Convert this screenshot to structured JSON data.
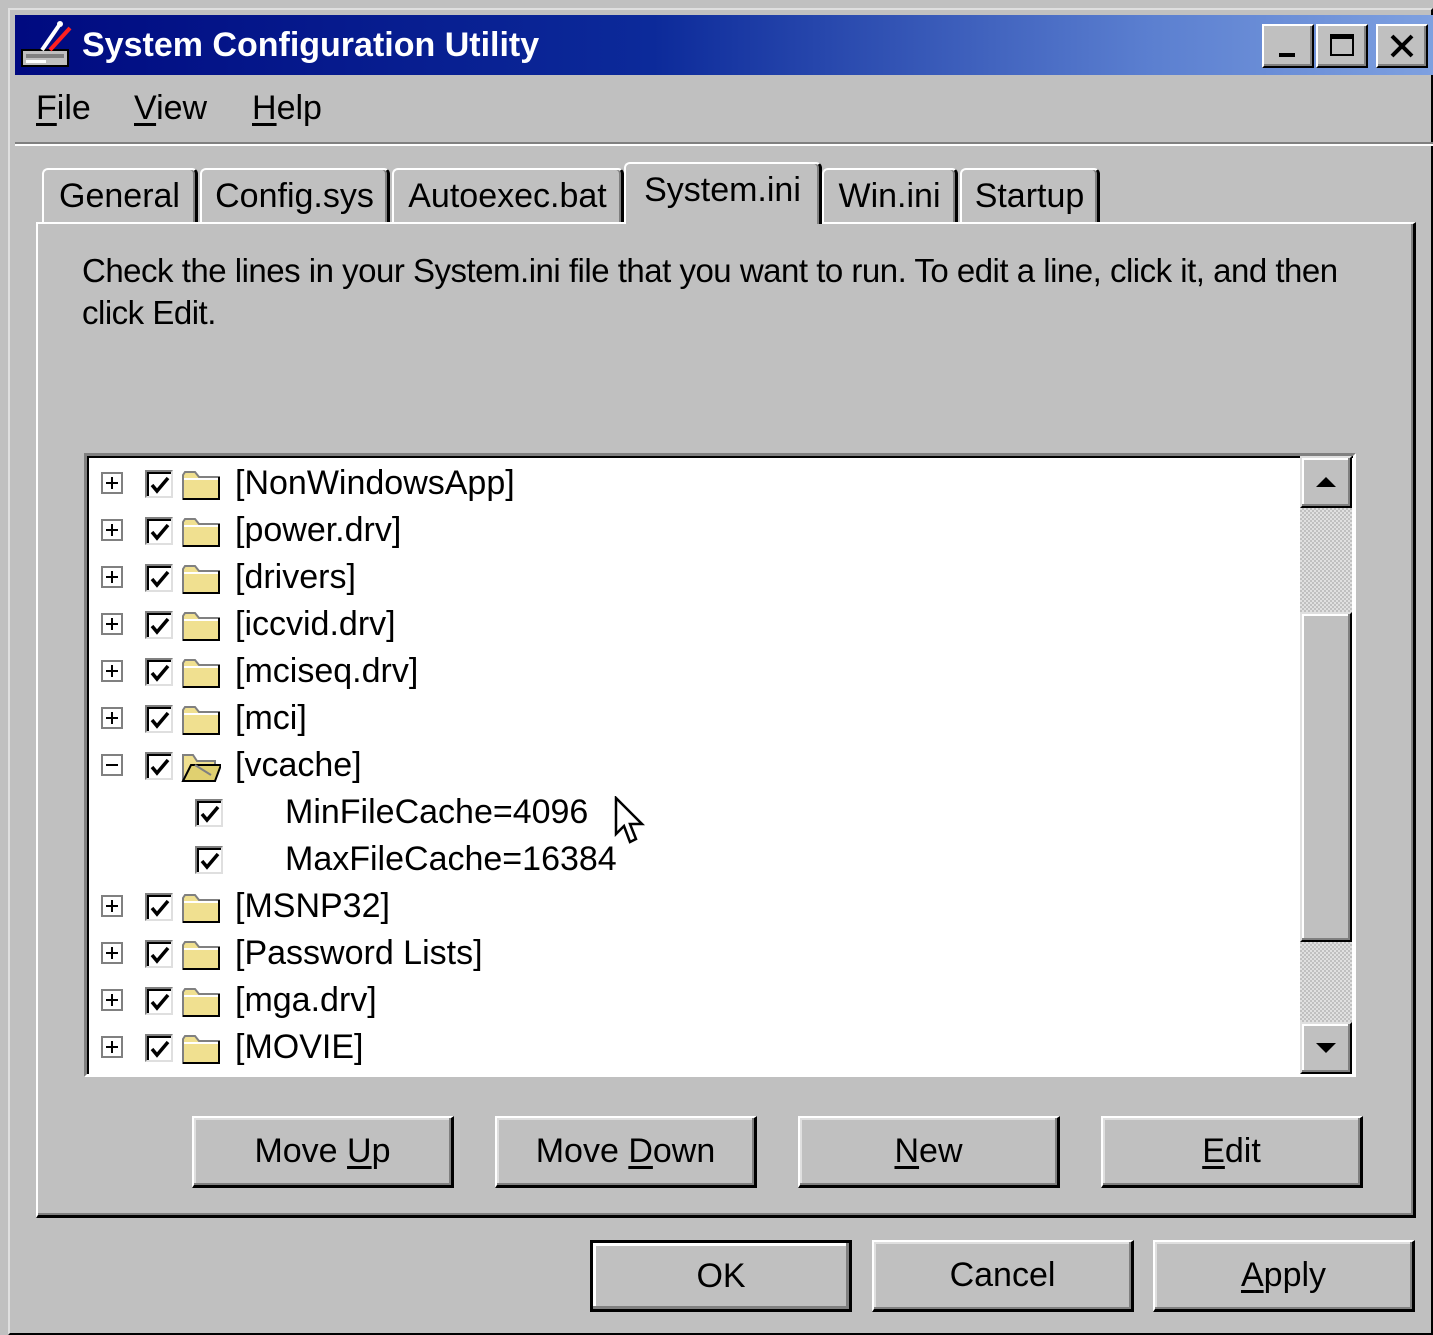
{
  "window": {
    "title": "System Configuration Utility"
  },
  "menu": [
    {
      "pre": "",
      "key": "F",
      "post": "ile"
    },
    {
      "pre": "",
      "key": "V",
      "post": "iew"
    },
    {
      "pre": "",
      "key": "H",
      "post": "elp"
    }
  ],
  "tabs": [
    "General",
    "Config.sys",
    "Autoexec.bat",
    "System.ini",
    "Win.ini",
    "Startup"
  ],
  "active_tab": "System.ini",
  "instructions": "Check the lines in your System.ini file that you want to run. To edit a line, click it, and then click Edit.",
  "tree": [
    {
      "label": "[NonWindowsApp]",
      "checked": true,
      "expander": "plus",
      "folder": "closed"
    },
    {
      "label": "[power.drv]",
      "checked": true,
      "expander": "plus",
      "folder": "closed"
    },
    {
      "label": "[drivers]",
      "checked": true,
      "expander": "plus",
      "folder": "closed"
    },
    {
      "label": "[iccvid.drv]",
      "checked": true,
      "expander": "plus",
      "folder": "closed"
    },
    {
      "label": "[mciseq.drv]",
      "checked": true,
      "expander": "plus",
      "folder": "closed"
    },
    {
      "label": "[mci]",
      "checked": true,
      "expander": "plus",
      "folder": "closed"
    },
    {
      "label": "[vcache]",
      "checked": true,
      "expander": "minus",
      "folder": "open"
    },
    {
      "label": "MinFileCache=4096",
      "checked": true,
      "expander": "none",
      "folder": "none"
    },
    {
      "label": "MaxFileCache=16384",
      "checked": true,
      "expander": "none",
      "folder": "none"
    },
    {
      "label": "[MSNP32]",
      "checked": true,
      "expander": "plus",
      "folder": "closed"
    },
    {
      "label": "[Password Lists]",
      "checked": true,
      "expander": "plus",
      "folder": "closed"
    },
    {
      "label": "[mga.drv]",
      "checked": true,
      "expander": "plus",
      "folder": "closed"
    },
    {
      "label": "[MOVIE]",
      "checked": true,
      "expander": "plus",
      "folder": "closed"
    }
  ],
  "actions": {
    "move_up": {
      "pre": "Move ",
      "key": "U",
      "post": "p"
    },
    "move_down": {
      "pre": "Move ",
      "key": "D",
      "post": "own"
    },
    "new": {
      "pre": "",
      "key": "N",
      "post": "ew"
    },
    "edit": {
      "pre": "",
      "key": "E",
      "post": "dit"
    }
  },
  "dialog_buttons": {
    "ok": "OK",
    "cancel": "Cancel",
    "apply": {
      "pre": "",
      "key": "A",
      "post": "pply"
    }
  },
  "colors": {
    "titlebar_start": "#000a80",
    "titlebar_end": "#7ea0e0",
    "face": "#c0c0c0",
    "folder": "#f0e090"
  }
}
